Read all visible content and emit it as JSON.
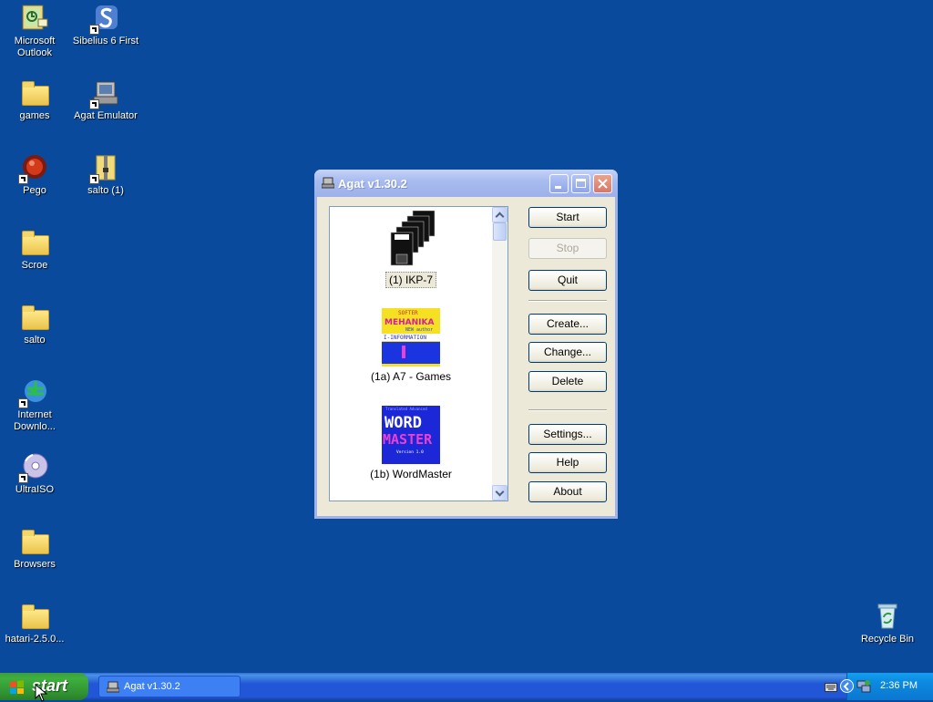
{
  "desktop": {
    "icons": [
      {
        "label": "Microsoft Outlook",
        "icon": "outlook-icon"
      },
      {
        "label": "Sibelius 6 First",
        "icon": "sibelius-icon"
      },
      {
        "label": "games",
        "icon": "folder-icon"
      },
      {
        "label": "Agat Emulator",
        "icon": "agat-emulator-icon"
      },
      {
        "label": "Pego",
        "icon": "pego-icon"
      },
      {
        "label": "salto (1)",
        "icon": "zip-folder-icon"
      },
      {
        "label": "Scroe",
        "icon": "folder-icon"
      },
      {
        "label": "salto",
        "icon": "folder-icon"
      },
      {
        "label": "Internet Downlo...",
        "icon": "internet-download-icon"
      },
      {
        "label": "UltraISO",
        "icon": "ultraiso-icon"
      },
      {
        "label": "Browsers",
        "icon": "folder-icon"
      },
      {
        "label": "hatari-2.5.0...",
        "icon": "folder-icon"
      },
      {
        "label": "Recycle Bin",
        "icon": "recycle-bin-icon"
      }
    ]
  },
  "window": {
    "title": "Agat v1.30.2",
    "list": [
      {
        "label": "(1) IKP-7",
        "thumb": "floppy-stack-icon",
        "selected": true
      },
      {
        "label": "(1a) A7 - Games",
        "thumb": "a7-games-thumb",
        "selected": false
      },
      {
        "label": "(1b) WordMaster",
        "thumb": "wordmaster-thumb",
        "selected": false
      }
    ],
    "thumb_text": {
      "a7_line1": "SOFTER",
      "a7_line2": "MEHANIKA",
      "a7_line3": "NEW author",
      "a7_line4": "I-INFORMATION",
      "wm_top": "Translated Advanced",
      "wm_line1": "WORD",
      "wm_line2": "MASTER",
      "wm_version": "Version 1.0"
    },
    "buttons": {
      "start": "Start",
      "stop": "Stop",
      "quit": "Quit",
      "create": "Create...",
      "change": "Change...",
      "delete": "Delete",
      "settings": "Settings...",
      "help": "Help",
      "about": "About"
    }
  },
  "taskbar": {
    "start_label": "start",
    "task": "Agat v1.30.2",
    "clock": "2:36 PM"
  },
  "colors": {
    "desktop": "#0a4a9c",
    "taskbar": "#2157d7",
    "start": "#3eb03e"
  }
}
